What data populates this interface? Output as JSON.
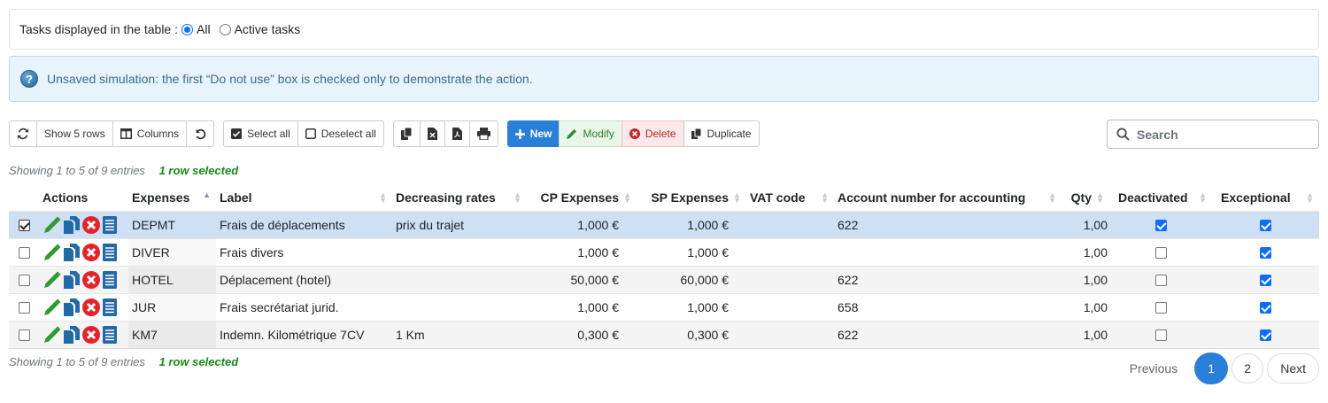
{
  "filter": {
    "label": "Tasks displayed in the table :",
    "options": [
      {
        "label": "All",
        "selected": true
      },
      {
        "label": "Active tasks",
        "selected": false
      }
    ]
  },
  "alert": {
    "icon": "question-icon",
    "text": "Unsaved simulation: the first “Do not use” box is checked only to demonstrate the action."
  },
  "toolbar": {
    "show_rows": "Show 5 rows",
    "columns": "Columns",
    "select_all": "Select all",
    "deselect_all": "Deselect all",
    "new": "New",
    "modify": "Modify",
    "delete": "Delete",
    "duplicate": "Duplicate"
  },
  "search": {
    "placeholder": "Search"
  },
  "info": {
    "showing": "Showing 1 to 5 of 9 entries",
    "selected": "1 row selected"
  },
  "table": {
    "columns": [
      "Actions",
      "Expenses",
      "Label",
      "Decreasing rates",
      "CP Expenses",
      "SP Expenses",
      "VAT code",
      "Account number for accounting",
      "Qty",
      "Deactivated",
      "Exceptional"
    ],
    "rows": [
      {
        "selected": true,
        "expense": "DEPMT",
        "label": "Frais de déplacements",
        "rate": "prix du trajet",
        "cp": "1,000 €",
        "sp": "1,000 €",
        "vat": "",
        "account": "622",
        "qty": "1,00",
        "deactivated": true,
        "exceptional": true
      },
      {
        "selected": false,
        "expense": "DIVER",
        "label": "Frais divers",
        "rate": "",
        "cp": "1,000 €",
        "sp": "1,000 €",
        "vat": "",
        "account": "",
        "qty": "1,00",
        "deactivated": false,
        "exceptional": true
      },
      {
        "selected": false,
        "expense": "HOTEL",
        "label": "Déplacement (hotel)",
        "rate": "",
        "cp": "50,000 €",
        "sp": "60,000 €",
        "vat": "",
        "account": "622",
        "qty": "1,00",
        "deactivated": false,
        "exceptional": true
      },
      {
        "selected": false,
        "expense": "JUR",
        "label": "Frais secrétariat jurid.",
        "rate": "",
        "cp": "1,000 €",
        "sp": "1,000 €",
        "vat": "",
        "account": "658",
        "qty": "1,00",
        "deactivated": false,
        "exceptional": true
      },
      {
        "selected": false,
        "expense": "KM7",
        "label": "Indemn. Kilométrique 7CV",
        "rate": "1 Km",
        "cp": "0,300 €",
        "sp": "0,300 €",
        "vat": "",
        "account": "622",
        "qty": "1,00",
        "deactivated": false,
        "exceptional": true
      }
    ]
  },
  "pager": {
    "previous": "Previous",
    "pages": [
      "1",
      "2"
    ],
    "current": "1",
    "next": "Next"
  },
  "colors": {
    "primary": "#2a7fd9",
    "selected_row": "#cfe0f5",
    "success_text": "#188a18"
  }
}
